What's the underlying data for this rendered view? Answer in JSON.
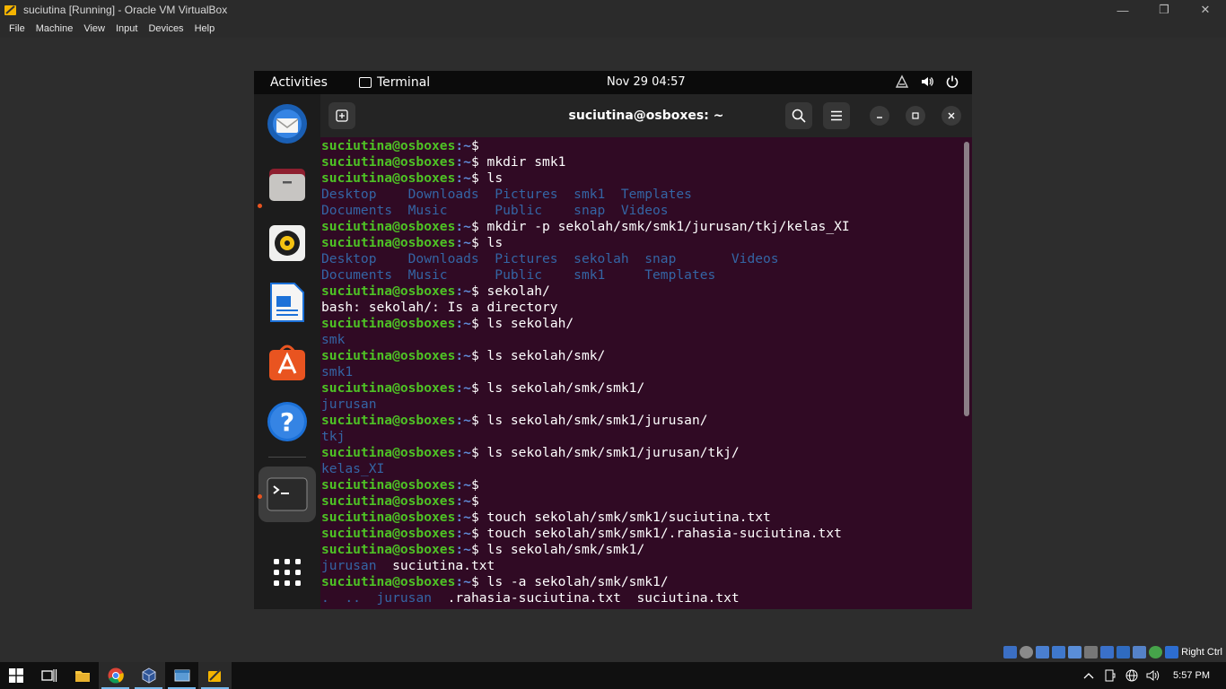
{
  "host": {
    "window_title": "suciutina [Running] - Oracle VM VirtualBox",
    "menu": [
      "File",
      "Machine",
      "View",
      "Input",
      "Devices",
      "Help"
    ],
    "host_key": "Right Ctrl"
  },
  "guest_topbar": {
    "activities": "Activities",
    "app_name": "Terminal",
    "clock": "Nov 29  04:57"
  },
  "terminal": {
    "title": "suciutina@osboxes: ~",
    "prompt_user": "suciutina@osboxes",
    "prompt_path": ":~",
    "prompt_symbol": "$ ",
    "lines": [
      {
        "type": "prompt",
        "cmd": ""
      },
      {
        "type": "prompt",
        "cmd": "mkdir smk1"
      },
      {
        "type": "prompt",
        "cmd": "ls"
      },
      {
        "type": "output",
        "segments": [
          {
            "t": "Desktop    Downloads  Pictures  smk1  Templates",
            "c": "dir"
          }
        ]
      },
      {
        "type": "output",
        "segments": [
          {
            "t": "Documents  Music      Public    snap  Videos",
            "c": "dir"
          }
        ]
      },
      {
        "type": "prompt",
        "cmd": "mkdir -p sekolah/smk/smk1/jurusan/tkj/kelas_XI"
      },
      {
        "type": "prompt",
        "cmd": "ls"
      },
      {
        "type": "output",
        "segments": [
          {
            "t": "Desktop    Downloads  Pictures  sekolah  snap       Videos",
            "c": "dir"
          }
        ]
      },
      {
        "type": "output",
        "segments": [
          {
            "t": "Documents  Music      Public    smk1     Templates",
            "c": "dir"
          }
        ]
      },
      {
        "type": "prompt",
        "cmd": "sekolah/"
      },
      {
        "type": "output",
        "segments": [
          {
            "t": "bash: sekolah/: Is a directory",
            "c": "plain"
          }
        ]
      },
      {
        "type": "prompt",
        "cmd": "ls sekolah/"
      },
      {
        "type": "output",
        "segments": [
          {
            "t": "smk",
            "c": "dir"
          }
        ]
      },
      {
        "type": "prompt",
        "cmd": "ls sekolah/smk/"
      },
      {
        "type": "output",
        "segments": [
          {
            "t": "smk1",
            "c": "dir"
          }
        ]
      },
      {
        "type": "prompt",
        "cmd": "ls sekolah/smk/smk1/"
      },
      {
        "type": "output",
        "segments": [
          {
            "t": "jurusan",
            "c": "dir"
          }
        ]
      },
      {
        "type": "prompt",
        "cmd": "ls sekolah/smk/smk1/jurusan/"
      },
      {
        "type": "output",
        "segments": [
          {
            "t": "tkj",
            "c": "dir"
          }
        ]
      },
      {
        "type": "prompt",
        "cmd": "ls sekolah/smk/smk1/jurusan/tkj/"
      },
      {
        "type": "output",
        "segments": [
          {
            "t": "kelas_XI",
            "c": "dir"
          }
        ]
      },
      {
        "type": "prompt",
        "cmd": ""
      },
      {
        "type": "prompt",
        "cmd": ""
      },
      {
        "type": "prompt",
        "cmd": "touch sekolah/smk/smk1/suciutina.txt"
      },
      {
        "type": "prompt",
        "cmd": "touch sekolah/smk/smk1/.rahasia-suciutina.txt"
      },
      {
        "type": "prompt",
        "cmd": "ls sekolah/smk/smk1/"
      },
      {
        "type": "output",
        "segments": [
          {
            "t": "jurusan",
            "c": "dir"
          },
          {
            "t": "  suciutina.txt",
            "c": "plain"
          }
        ]
      },
      {
        "type": "prompt",
        "cmd": "ls -a sekolah/smk/smk1/"
      },
      {
        "type": "output",
        "segments": [
          {
            "t": ".  ..  ",
            "c": "dir"
          },
          {
            "t": "jurusan",
            "c": "dir"
          },
          {
            "t": "  .rahasia-suciutina.txt  suciutina.txt",
            "c": "plain"
          }
        ]
      }
    ]
  },
  "dock": [
    "thunderbird-icon",
    "files-icon",
    "rhythmbox-icon",
    "libreoffice-writer-icon",
    "ubuntu-software-icon",
    "help-icon",
    "terminal-icon",
    "show-apps-icon"
  ],
  "taskbar": {
    "clock": "5:57 PM"
  },
  "colors": {
    "terminal_bg": "#300a24",
    "prompt_user": "#4ec225",
    "prompt_path": "#5f8ad6",
    "directory": "#3465a4",
    "accent": "#e95420"
  }
}
